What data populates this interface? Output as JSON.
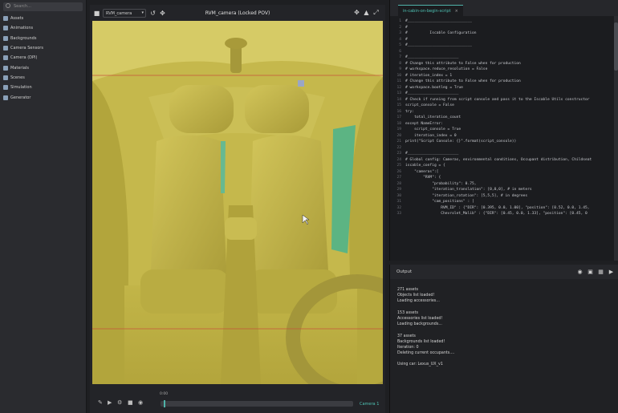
{
  "sidebar": {
    "search_placeholder": "Search...",
    "items": [
      {
        "label": "Assets",
        "icon": "assets-icon"
      },
      {
        "label": "Animations",
        "icon": "animations-icon"
      },
      {
        "label": "Backgrounds",
        "icon": "backgrounds-icon"
      },
      {
        "label": "Camera Sensors",
        "icon": "camera-icon"
      },
      {
        "label": "Camera (DPI)",
        "icon": "camera-icon"
      },
      {
        "label": "Materials",
        "icon": "materials-icon"
      },
      {
        "label": "Scenes",
        "icon": "scenes-icon"
      },
      {
        "label": "Simulation",
        "icon": "simulation-icon"
      },
      {
        "label": "Generator",
        "icon": "generator-icon"
      }
    ]
  },
  "viewport": {
    "camera_select": "RVM_camera",
    "title": "RVM_camera (Locked POV)",
    "timeline_label": "0:00",
    "camera_label": "Camera 1"
  },
  "editor": {
    "tab_label": "in-cabin-on-begin-script",
    "close_glyph": "×",
    "lines": [
      {
        "n": "1",
        "t": "#_____________________________"
      },
      {
        "n": "2",
        "t": "#"
      },
      {
        "n": "3",
        "t": "#          Iscable Configuration"
      },
      {
        "n": "4",
        "t": "#"
      },
      {
        "n": "5",
        "t": "#_____________________________"
      },
      {
        "n": "6",
        "t": ""
      },
      {
        "n": "7",
        "t": "#_______________________"
      },
      {
        "n": "8",
        "t": "# Change this attribute to False when for production"
      },
      {
        "n": "9",
        "t": "# workspace.reduce_resolution = False"
      },
      {
        "n": "10",
        "t": "# iteration_index = 1"
      },
      {
        "n": "11",
        "t": "# Change this attribute to False when for production"
      },
      {
        "n": "12",
        "t": "# workspace.bootleg = True"
      },
      {
        "n": "13",
        "t": "#_______________________"
      },
      {
        "n": "14",
        "t": "# Check if running from script console and pass it to the Iscable Utils constructor"
      },
      {
        "n": "15",
        "t": "script_console = False"
      },
      {
        "n": "16",
        "t": "try:"
      },
      {
        "n": "17",
        "t": "    total_iteration_count"
      },
      {
        "n": "18",
        "t": "except NameError:"
      },
      {
        "n": "19",
        "t": "    script_console = True"
      },
      {
        "n": "20",
        "t": "    iteration_index = 0"
      },
      {
        "n": "21",
        "t": "print(\"Script Console: {}\".format(script_console))"
      },
      {
        "n": "22",
        "t": ""
      },
      {
        "n": "23",
        "t": "#_______________________"
      },
      {
        "n": "24",
        "t": "# Global config: Cameras, environmental conditions, Occupant distribution, Childseat"
      },
      {
        "n": "25",
        "t": "iscable_config = {"
      },
      {
        "n": "26",
        "t": "    \"cameras\":["
      },
      {
        "n": "27",
        "t": "        \"RVM\": {"
      },
      {
        "n": "28",
        "t": "            \"probability\": 0.75,"
      },
      {
        "n": "29",
        "t": "            \"iteration_translation\": [0,0,0], # in meters"
      },
      {
        "n": "30",
        "t": "            \"iteration_rotation\": [5,5,5], # in degrees"
      },
      {
        "n": "31",
        "t": "            \"cam_positions\" : ["
      },
      {
        "n": "32",
        "t": "                RVM_ID\" : {\"DIR\": [0.395, 0.0, 1.00], \"position\": [0.52, 0.0, 1.45,"
      },
      {
        "n": "33",
        "t": "                Chevrolet_Malib\" : {\"DIR\": [0.45, 0.0, 1.33], \"position\": [0.45, 0"
      }
    ]
  },
  "output": {
    "title": "Output",
    "lines": [
      "271 assets",
      "Objects list loaded!",
      "Loading accessories...",
      "",
      "153 assets",
      "Accessories list loaded!",
      "Loading backgrounds...",
      "",
      "37 assets",
      "Backgrounds list loaded!",
      "Iteration: 0",
      "Deleting current occupants....",
      "",
      "Using car: Lexus_UX_v1"
    ]
  },
  "colors": {
    "viewport_fill": "#c7b94c",
    "accent": "#4fb3a9",
    "panel_bg": "#1e1f22"
  }
}
